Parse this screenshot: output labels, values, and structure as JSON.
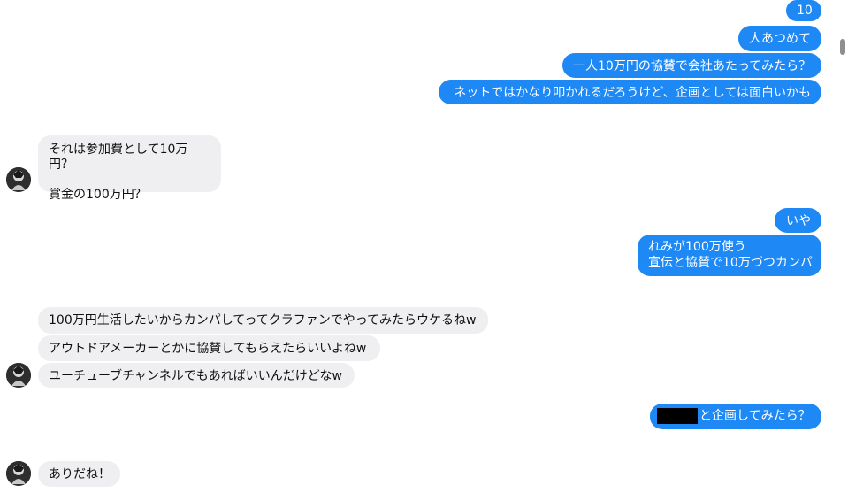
{
  "messages": {
    "m1": "10",
    "m2": "人あつめて",
    "m3": "一人10万円の協賛で会社あたってみたら？",
    "m4": "ネットではかなり叩かれるだろうけど、企画としては面白いかも",
    "m5_line1": "それは参加費として10万円？",
    "m5_line2": "賞金の100万円？",
    "m6": "いや",
    "m7_line1": "れみが100万使う",
    "m7_line2": "宣伝と協賛で10万づつカンパ",
    "m8": "100万円生活したいからカンパしてってクラファンでやってみたらウケるねw",
    "m9": "アウトドアメーカーとかに協賛してもらえたらいいよねw",
    "m10": "ユーチューブチャンネルでもあればいいんだけどなw",
    "m11_suffix": "と企画してみたら？",
    "m12": "ありだね！"
  },
  "colors": {
    "outgoing_bubble": "#1e88f5",
    "incoming_bubble": "#efeff1",
    "background": "#ffffff"
  },
  "icons": {
    "avatar": "avatar-icon",
    "redaction": "redaction-block"
  }
}
